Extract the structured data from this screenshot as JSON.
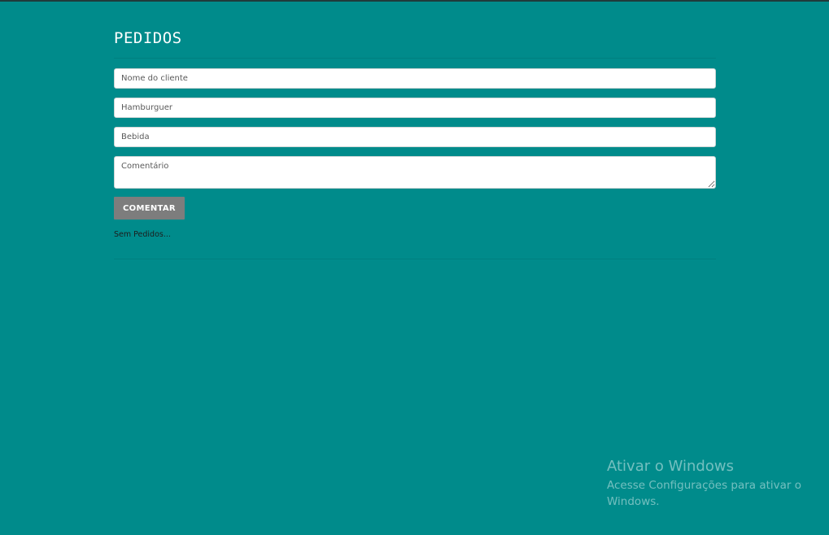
{
  "page": {
    "title": "PEDIDOS"
  },
  "form": {
    "client_placeholder": "Nome do cliente",
    "burger_placeholder": "Hamburguer",
    "drink_placeholder": "Bebida",
    "comment_placeholder": "Comentário",
    "submit_label": "COMENTAR"
  },
  "orders": {
    "empty_text": "Sem Pedidos..."
  },
  "watermark": {
    "title": "Ativar o Windows",
    "subtitle": "Acesse Configurações para ativar o Windows."
  },
  "colors": {
    "background": "#008b8b",
    "button": "#7d7d7d"
  }
}
